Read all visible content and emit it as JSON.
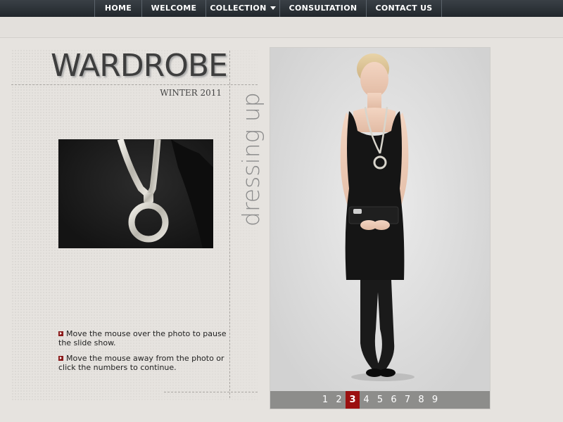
{
  "nav": {
    "items": [
      {
        "label": "HOME"
      },
      {
        "label": "WELCOME"
      },
      {
        "label": "COLLECTION",
        "has_dropdown": true
      },
      {
        "label": "CONSULTATION"
      },
      {
        "label": "CONTACT US"
      }
    ]
  },
  "page": {
    "title": "WARDROBE",
    "season": "WINTER 2011",
    "tag": "dressing up"
  },
  "instructions": [
    {
      "text": "Move the mouse over the photo to pause the slide show."
    },
    {
      "text": "Move the mouse away from the photo or click the numbers to continue."
    }
  ],
  "slideshow": {
    "pages": [
      "1",
      "2",
      "3",
      "4",
      "5",
      "6",
      "7",
      "8",
      "9"
    ],
    "active": "3"
  },
  "colors": {
    "nav_bg": "#2a3036",
    "background": "#e6e3df",
    "accent": "#9b1010",
    "pager_bg": "#8d8d8b"
  },
  "icons": {
    "bullet": "arrow-bullet-icon",
    "dropdown": "chevron-down-icon"
  }
}
